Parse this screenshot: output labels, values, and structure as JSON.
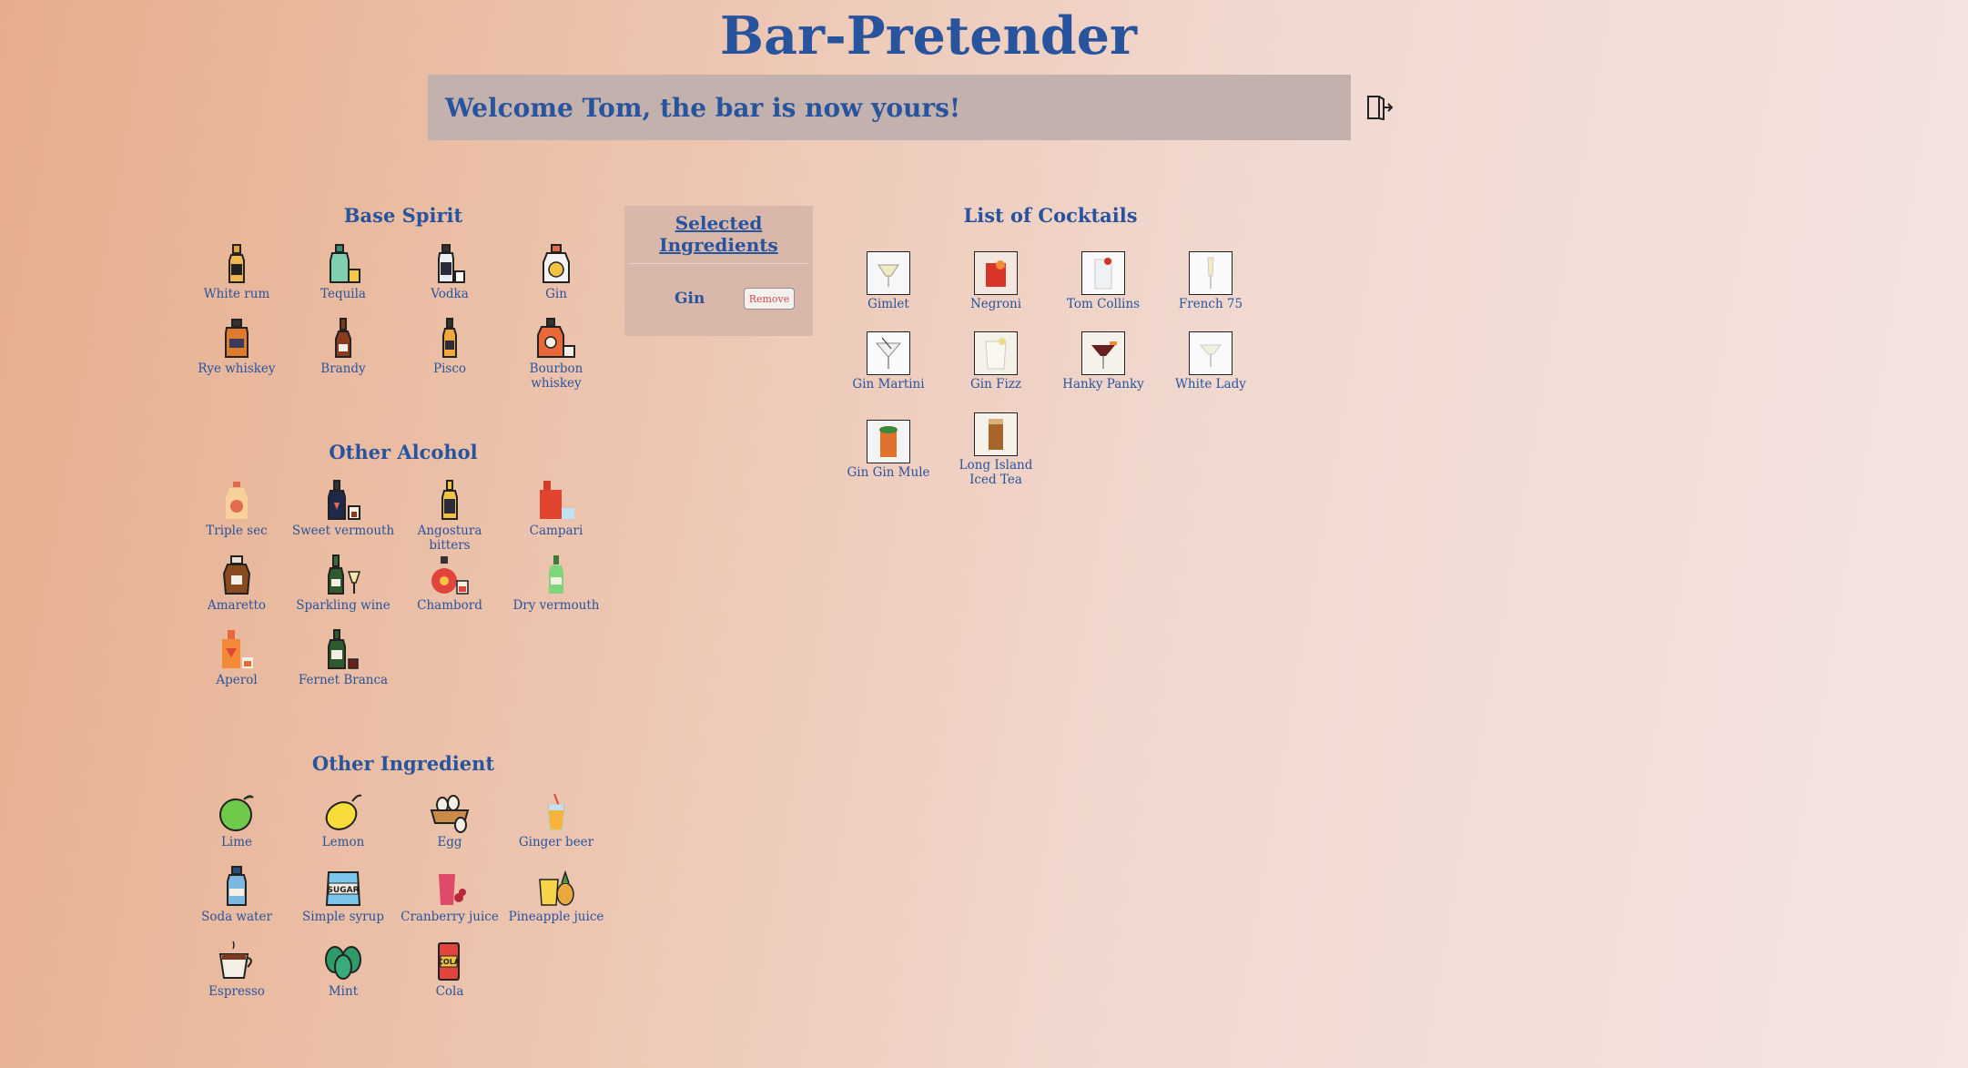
{
  "app": {
    "title": "Bar-Pretender",
    "welcome": "Welcome Tom, the bar is now yours!"
  },
  "base_spirit": {
    "title": "Base Spirit",
    "items": [
      "White rum",
      "Tequila",
      "Vodka",
      "Gin",
      "Rye whiskey",
      "Brandy",
      "Pisco",
      "Bourbon whiskey"
    ]
  },
  "other_alcohol": {
    "title": "Other Alcohol",
    "items": [
      "Triple sec",
      "Sweet vermouth",
      "Angostura bitters",
      "Campari",
      "Amaretto",
      "Sparkling wine",
      "Chambord",
      "Dry vermouth",
      "Aperol",
      "Fernet Branca"
    ]
  },
  "other_ingredient": {
    "title": "Other Ingredient",
    "items": [
      "Lime",
      "Lemon",
      "Egg",
      "Ginger beer",
      "Soda water",
      "Simple syrup",
      "Cranberry juice",
      "Pineapple juice",
      "Espresso",
      "Mint",
      "Cola"
    ]
  },
  "selected": {
    "title_line1": "Selected",
    "title_line2": "Ingredients",
    "items": [
      {
        "name": "Gin",
        "remove_label": "Remove"
      }
    ]
  },
  "cocktails": {
    "title": "List of Cocktails",
    "items": [
      {
        "line1": "Gimlet",
        "line2": ""
      },
      {
        "line1": "Negroni",
        "line2": ""
      },
      {
        "line1": "Tom Collins",
        "line2": ""
      },
      {
        "line1": "French 75",
        "line2": ""
      },
      {
        "line1": "Gin Martini",
        "line2": ""
      },
      {
        "line1": "Gin Fizz",
        "line2": ""
      },
      {
        "line1": "Hanky Panky",
        "line2": ""
      },
      {
        "line1": "White Lady",
        "line2": ""
      },
      {
        "line1": "Gin Gin Mule",
        "line2": ""
      },
      {
        "line1": "Long Island",
        "line2": "Iced Tea"
      }
    ]
  },
  "colors": {
    "accent": "#28539d",
    "remove": "#d04b4b",
    "panel": "#d9b8ab",
    "welcome_bar": "#c2b1ad"
  }
}
